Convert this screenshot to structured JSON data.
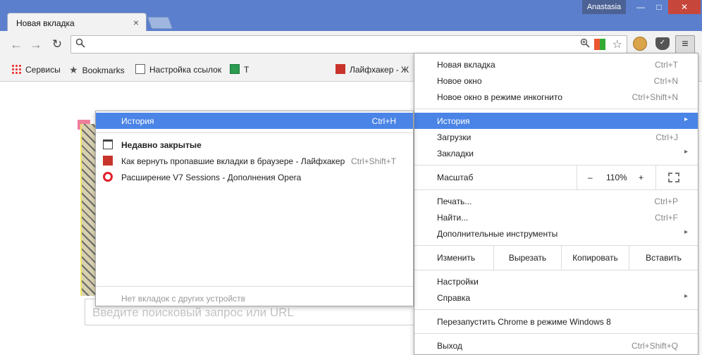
{
  "window": {
    "profile_name": "Anastasia",
    "min_glyph": "—",
    "max_glyph": "□",
    "close_glyph": "✕"
  },
  "tabs": [
    {
      "title": "Новая вкладка",
      "close_glyph": "×"
    }
  ],
  "toolbar": {
    "back_glyph": "←",
    "forward_glyph": "→",
    "reload_glyph": "↻",
    "omnibox_value": "",
    "menu_glyph": "≡"
  },
  "bookmarks": [
    {
      "label": "Сервисы",
      "icon": "apps-grid-icon"
    },
    {
      "label": "Bookmarks",
      "icon": "star-icon"
    },
    {
      "label": "Настройка ссылок",
      "icon": "document-icon"
    },
    {
      "label": "Т",
      "icon": "sheets-icon"
    },
    {
      "label": "Лайфхакер - Ж",
      "icon": "lifehacker-icon"
    }
  ],
  "page": {
    "search_placeholder": "Введите поисковый запрос или URL"
  },
  "main_menu": {
    "items_top": [
      {
        "label": "Новая вкладка",
        "shortcut": "Ctrl+T"
      },
      {
        "label": "Новое окно",
        "shortcut": "Ctrl+N"
      },
      {
        "label": "Новое окно в режиме инкогнито",
        "shortcut": "Ctrl+Shift+N"
      }
    ],
    "history": {
      "label": "История",
      "arrow": "▸"
    },
    "downloads": {
      "label": "Загрузки",
      "shortcut": "Ctrl+J"
    },
    "bookmarks": {
      "label": "Закладки",
      "arrow": "▸"
    },
    "zoom": {
      "label": "Масштаб",
      "minus": "–",
      "value": "110%",
      "plus": "+"
    },
    "print": {
      "label": "Печать...",
      "shortcut": "Ctrl+P"
    },
    "find": {
      "label": "Найти...",
      "shortcut": "Ctrl+F"
    },
    "more_tools": {
      "label": "Дополнительные инструменты",
      "arrow": "▸"
    },
    "edit": {
      "label": "Изменить",
      "cut": "Вырезать",
      "copy": "Копировать",
      "paste": "Вставить"
    },
    "settings": {
      "label": "Настройки"
    },
    "help": {
      "label": "Справка",
      "arrow": "▸"
    },
    "relaunch": {
      "label": "Перезапустить Chrome в режиме Windows 8"
    },
    "exit": {
      "label": "Выход",
      "shortcut": "Ctrl+Shift+Q"
    }
  },
  "history_submenu": {
    "header": {
      "label": "История",
      "shortcut": "Ctrl+H"
    },
    "recently_closed": "Недавно закрытые",
    "entries": [
      {
        "label": "Как вернуть пропавшие вкладки в браузере - Лайфхакер",
        "shortcut": "Ctrl+Shift+T",
        "icon": "lifehacker-icon"
      },
      {
        "label": "Расширение V7 Sessions - Дополнения Opera",
        "shortcut": "",
        "icon": "opera-icon"
      }
    ],
    "no_tabs": "Нет вкладок с других устройств"
  }
}
